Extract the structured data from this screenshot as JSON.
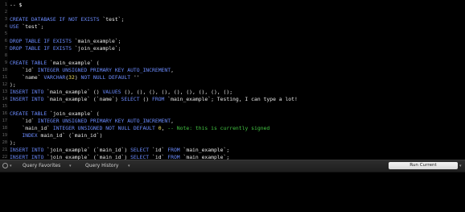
{
  "editor": {
    "lines": [
      {
        "n": "1",
        "segs": [
          {
            "t": "-- $",
            "c": "cursor-text"
          }
        ]
      },
      {
        "n": "2",
        "segs": []
      },
      {
        "n": "3",
        "segs": [
          {
            "t": "CREATE DATABASE IF NOT EXISTS ",
            "c": "kw"
          },
          {
            "t": "`test`;",
            "c": "str"
          }
        ]
      },
      {
        "n": "4",
        "segs": [
          {
            "t": "USE ",
            "c": "kw"
          },
          {
            "t": "`test`;",
            "c": "str"
          }
        ]
      },
      {
        "n": "5",
        "segs": []
      },
      {
        "n": "6",
        "segs": [
          {
            "t": "DROP TABLE IF EXISTS ",
            "c": "kw"
          },
          {
            "t": "`main_example`;",
            "c": "str"
          }
        ]
      },
      {
        "n": "7",
        "segs": [
          {
            "t": "DROP TABLE IF EXISTS ",
            "c": "kw"
          },
          {
            "t": "`join_example`;",
            "c": "str"
          }
        ]
      },
      {
        "n": "8",
        "segs": []
      },
      {
        "n": "9",
        "segs": [
          {
            "t": "CREATE TABLE ",
            "c": "kw"
          },
          {
            "t": "`main_example` (",
            "c": "str"
          }
        ]
      },
      {
        "n": "10",
        "segs": [
          {
            "t": "    `id` ",
            "c": "str"
          },
          {
            "t": "INTEGER UNSIGNED PRIMARY KEY AUTO_INCREMENT",
            "c": "kw"
          },
          {
            "t": ",",
            "c": "str"
          }
        ]
      },
      {
        "n": "11",
        "segs": [
          {
            "t": "    `name` ",
            "c": "str"
          },
          {
            "t": "VARCHAR",
            "c": "kw"
          },
          {
            "t": "(",
            "c": "str"
          },
          {
            "t": "32",
            "c": "num"
          },
          {
            "t": ") ",
            "c": "str"
          },
          {
            "t": "NOT NULL DEFAULT ",
            "c": "kw"
          },
          {
            "t": "''",
            "c": "str"
          }
        ]
      },
      {
        "n": "12",
        "segs": [
          {
            "t": ");",
            "c": "str"
          }
        ]
      },
      {
        "n": "13",
        "segs": [
          {
            "t": "INSERT INTO ",
            "c": "kw"
          },
          {
            "t": "`main_example` () ",
            "c": "str"
          },
          {
            "t": "VALUES ",
            "c": "kw"
          },
          {
            "t": "(), (), (), (), (), (), (), (), ();",
            "c": "str"
          }
        ]
      },
      {
        "n": "14",
        "segs": [
          {
            "t": "INSERT INTO ",
            "c": "kw"
          },
          {
            "t": "`main_example` (`name`) ",
            "c": "str"
          },
          {
            "t": "SELECT ",
            "c": "kw"
          },
          {
            "t": "() ",
            "c": "str"
          },
          {
            "t": "FROM ",
            "c": "kw"
          },
          {
            "t": "`main_example`; Testing, I can type a lot!",
            "c": "str"
          }
        ]
      },
      {
        "n": "15",
        "segs": []
      },
      {
        "n": "16",
        "segs": [
          {
            "t": "CREATE TABLE ",
            "c": "kw"
          },
          {
            "t": "`join_example` (",
            "c": "str"
          }
        ]
      },
      {
        "n": "17",
        "segs": [
          {
            "t": "    `id` ",
            "c": "str"
          },
          {
            "t": "INTEGER UNSIGNED PRIMARY KEY AUTO_INCREMENT",
            "c": "kw"
          },
          {
            "t": ",",
            "c": "str"
          }
        ]
      },
      {
        "n": "18",
        "segs": [
          {
            "t": "    `main_id` ",
            "c": "str"
          },
          {
            "t": "INTEGER UNSIGNED NOT NULL DEFAULT ",
            "c": "kw"
          },
          {
            "t": "0",
            "c": "num"
          },
          {
            "t": ", ",
            "c": "str"
          },
          {
            "t": "-- Note: this is currently signed",
            "c": "cm"
          }
        ]
      },
      {
        "n": "19",
        "segs": [
          {
            "t": "    ",
            "c": "str"
          },
          {
            "t": "INDEX ",
            "c": "kw"
          },
          {
            "t": "main_id` (`main_id`)",
            "c": "str"
          }
        ]
      },
      {
        "n": "20",
        "segs": [
          {
            "t": ");",
            "c": "str"
          }
        ]
      },
      {
        "n": "21",
        "segs": [
          {
            "t": "INSERT INTO ",
            "c": "kw"
          },
          {
            "t": "`join_example` (`main_id`) ",
            "c": "str"
          },
          {
            "t": "SELECT ",
            "c": "kw"
          },
          {
            "t": "`id` ",
            "c": "str"
          },
          {
            "t": "FROM ",
            "c": "kw"
          },
          {
            "t": "`main_example`;",
            "c": "str"
          }
        ]
      },
      {
        "n": "22",
        "segs": [
          {
            "t": "INSERT INTO ",
            "c": "kw"
          },
          {
            "t": "`join_example` (`main_id`) ",
            "c": "str"
          },
          {
            "t": "SELECT ",
            "c": "kw"
          },
          {
            "t": "`id` ",
            "c": "str"
          },
          {
            "t": "FROM ",
            "c": "kw"
          },
          {
            "t": "`main_example`;",
            "c": "str"
          }
        ]
      }
    ]
  },
  "toolbar": {
    "favorites_label": "Query Favorites",
    "history_label": "Query History",
    "run_label": "Run Current"
  },
  "colors": {
    "keyword": "#6c8cff",
    "number": "#f0e060",
    "comment": "#43c443",
    "text": "#e8e8e8"
  },
  "icons": {
    "settings": "gear-icon",
    "dropdown": "chevron-down-icon"
  }
}
